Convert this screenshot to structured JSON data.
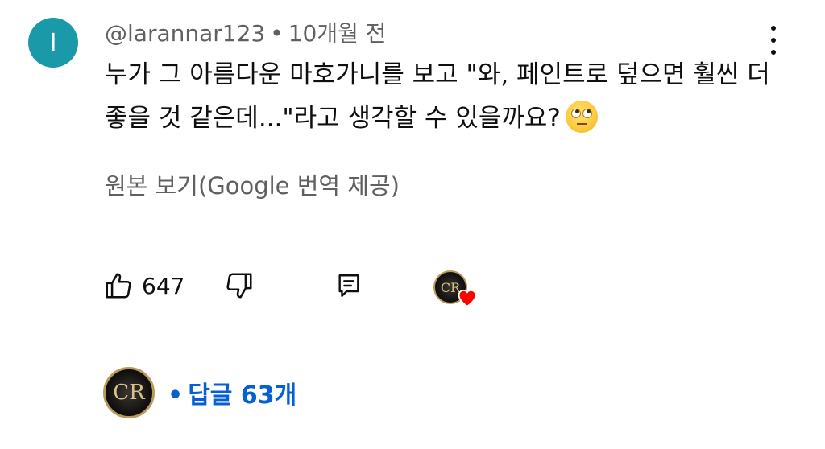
{
  "comment": {
    "avatar_letter": "I",
    "avatar_color": "#1a9aa8",
    "author": "@larannar123",
    "separator": "•",
    "time": "10개월 전",
    "text": "누가 그 아름다운 마호가니를 보고 \"와, 페인트로 덮으면 훨씬 더 좋을 것 같은데...\"라고 생각할 수 있을까요?",
    "emoji": "face-with-rolling-eyes",
    "translate_label": "원본 보기(Google 번역 제공)"
  },
  "actions": {
    "like_icon": "thumbs-up-icon",
    "like_count": "647",
    "dislike_icon": "thumbs-down-icon",
    "reply_icon": "reply-icon",
    "creator_heart": {
      "avatar_text": "CR",
      "heart_color": "#ff0000"
    }
  },
  "replies": {
    "avatar_text": "CR",
    "separator": "•",
    "label": "답글 63개",
    "color": "#065fd4"
  },
  "menu_icon": "more-vertical-icon"
}
